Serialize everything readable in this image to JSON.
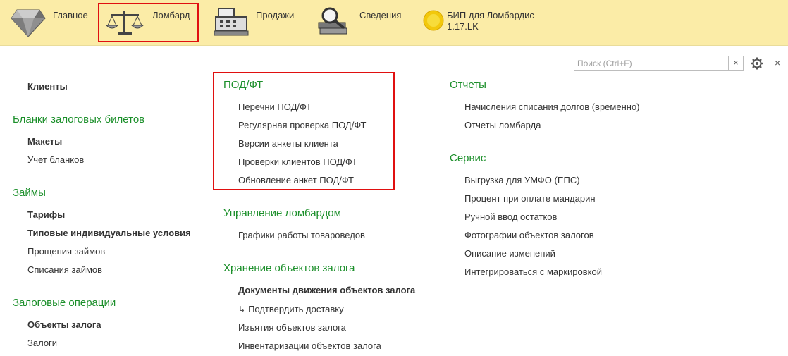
{
  "nav": {
    "home_label": "Главное",
    "pawn_label": "Ломбард",
    "sales_label": "Продажи",
    "info_label": "Сведения",
    "bip_title_line1": "БИП для Ломбардис",
    "bip_title_line2": "1.17.LK"
  },
  "search": {
    "placeholder": "Поиск (Ctrl+F)",
    "clear_symbol": "×",
    "close_symbol": "×"
  },
  "col1": {
    "clients": "Клиенты",
    "sec_blanks": "Бланки залоговых билетов",
    "blanks_items": [
      "Макеты",
      "Учет бланков"
    ],
    "sec_loans": "Займы",
    "loans_items": [
      "Тарифы",
      "Типовые индивидуальные условия",
      "Прощения займов",
      "Списания займов"
    ],
    "sec_pledge_ops": "Залоговые операции",
    "pledge_items": [
      "Объекты залога",
      "Залоги"
    ]
  },
  "col2": {
    "sec_podft": "ПОД/ФТ",
    "podft_items": [
      "Перечни ПОД/ФТ",
      "Регулярная проверка ПОД/ФТ",
      "Версии анкеты клиента",
      "Проверки клиентов ПОД/ФТ",
      "Обновление анкет ПОД/ФТ"
    ],
    "sec_manage": "Управление ломбардом",
    "manage_items": [
      "Графики работы товароведов"
    ],
    "sec_storage": "Хранение объектов залога",
    "storage_items": [
      "Документы движения объектов залога",
      "Подтвердить доставку",
      "Изъятия объектов залога",
      "Инвентаризации объектов залога"
    ],
    "sub_arrow": "↳"
  },
  "col3": {
    "sec_reports": "Отчеты",
    "reports_items": [
      "Начисления списания долгов (временно)",
      "Отчеты ломбарда"
    ],
    "sec_service": "Сервис",
    "service_items": [
      "Выгрузка для УМФО (ЕПС)",
      "Процент при оплате мандарин",
      "Ручной ввод остатков",
      "Фотографии объектов залогов",
      "Описание изменений",
      "Интегрироваться с маркировкой"
    ]
  },
  "colors": {
    "topbar": "#fbeca7",
    "section_green": "#1b8f2a",
    "highlight_red": "#e01010"
  }
}
